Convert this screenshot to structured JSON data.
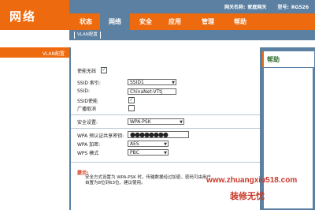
{
  "brand": {
    "logo": "网络"
  },
  "header": {
    "gateway_label": "网关名称:",
    "gateway_value": "家庭网关",
    "model_label": "型号:",
    "model_value": "RG526"
  },
  "menu": {
    "tabs": [
      {
        "label": "状态"
      },
      {
        "label": "网络"
      },
      {
        "label": "安全"
      },
      {
        "label": "应用"
      },
      {
        "label": "管理"
      },
      {
        "label": "帮助"
      }
    ],
    "active": "网络"
  },
  "subnav": {
    "item": "VLAN配置"
  },
  "sidebar": {
    "title": "VLAN配置"
  },
  "help": {
    "title": "帮助"
  },
  "form": {
    "enable_wireless": {
      "label": "使能无线",
      "checked": true
    },
    "ssid_index": {
      "label": "SSID 索引:",
      "value": "SSID1"
    },
    "ssid": {
      "label": "SSID:",
      "value": "ChinaNet-VTtj"
    },
    "ssid_enable": {
      "label": "SSID使能",
      "checked": true
    },
    "broadcast_cancel": {
      "label": "广播取消",
      "checked": false
    },
    "security": {
      "label": "安全设置:",
      "value": "WPA-PSK"
    },
    "wpa_key": {
      "label": "WPA 预认证共享密钥:",
      "value": "●●●●●●●●"
    },
    "wpa_encrypt": {
      "label": "WPA 加密:",
      "value": "AES"
    },
    "wps_mode": {
      "label": "WPS 模式",
      "value": "PBC"
    }
  },
  "tips": {
    "title": "提示:",
    "text": "安全方式设置为 WPA-PSK 时，传输数据经过加密。密码可由用户自置为8位到63位。建议使用。"
  },
  "watermark": {
    "url": "www.zhuangxiu518.com",
    "name": "装修无忧"
  },
  "colors": {
    "orange": "#ee6a0e",
    "blue": "#5b80a1"
  }
}
